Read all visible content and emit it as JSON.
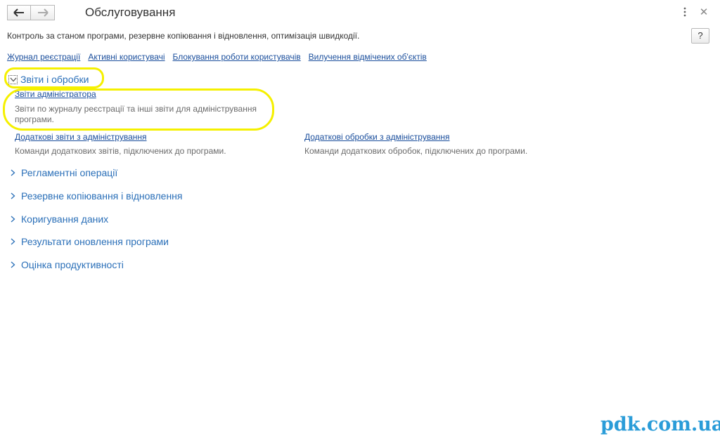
{
  "window": {
    "title": "Обслуговування"
  },
  "toolbar": {
    "help_label": "?"
  },
  "description": "Контроль за станом програми, резервне копіювання і відновлення, оптимізація швидкодії.",
  "links": [
    {
      "label": "Журнал реєстрації"
    },
    {
      "label": "Активні користувачі"
    },
    {
      "label": "Блокування роботи користувачів"
    },
    {
      "label": "Вилучення відмічених об'єктів"
    }
  ],
  "reports_section": {
    "title": "Звіти і обробки",
    "items": [
      {
        "label": "Звіти адміністратора",
        "desc": "Звіти по журналу реєстрації та інші звіти для адміністрування програми."
      },
      {
        "label": "Додаткові звіти з адміністрування",
        "desc": "Команди додаткових звітів, підключених до програми."
      },
      {
        "label": "Додаткові обробки з адміністрування",
        "desc": "Команди додаткових обробок, підключених до програми."
      }
    ]
  },
  "sections": [
    {
      "title": "Регламентні операції"
    },
    {
      "title": "Резервне копіювання і відновлення"
    },
    {
      "title": "Коригування даних"
    },
    {
      "title": "Результати оновлення програми"
    },
    {
      "title": "Оцінка продуктивності"
    }
  ],
  "watermark": "pdk.com.ua",
  "colors": {
    "link": "#1a4e9c",
    "section": "#2a6fb8",
    "highlight": "#f5f000",
    "watermark": "#2a9cd8"
  }
}
